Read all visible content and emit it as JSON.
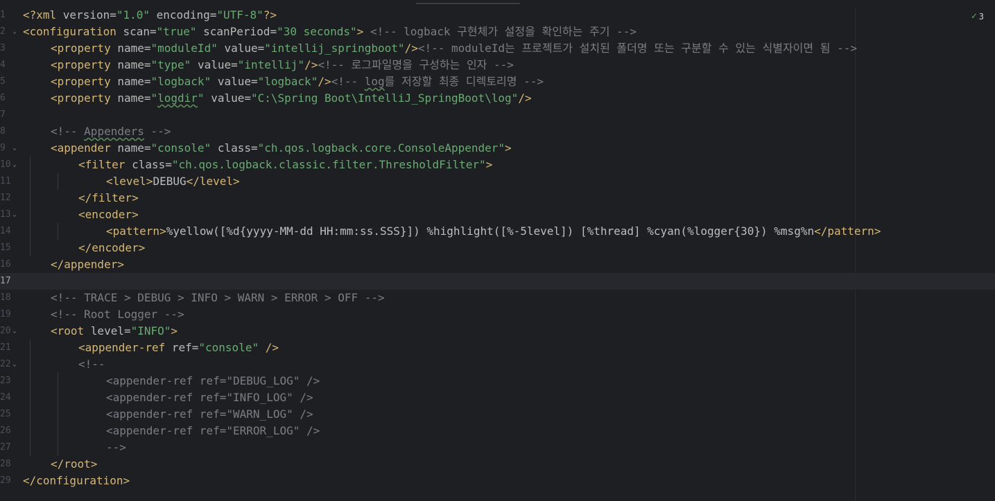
{
  "inspection": {
    "count": "3"
  },
  "current_line": 17,
  "lines": [
    {
      "n": "1",
      "fold": "",
      "indent": 0,
      "tokens": [
        {
          "c": "t",
          "s": "<?xml "
        },
        {
          "c": "a",
          "s": "version="
        },
        {
          "c": "v",
          "s": "\"1.0\" "
        },
        {
          "c": "a",
          "s": "encoding="
        },
        {
          "c": "v",
          "s": "\"UTF-8\""
        },
        {
          "c": "t",
          "s": "?>"
        }
      ]
    },
    {
      "n": "2",
      "fold": "v",
      "indent": 0,
      "tokens": [
        {
          "c": "t",
          "s": "<configuration "
        },
        {
          "c": "a",
          "s": "scan="
        },
        {
          "c": "v",
          "s": "\"true\" "
        },
        {
          "c": "a",
          "s": "scanPeriod="
        },
        {
          "c": "v",
          "s": "\"30 seconds\""
        },
        {
          "c": "t",
          "s": "> "
        },
        {
          "c": "c",
          "s": "<!-- logback 구현체가 설정을 확인하는 주기 -->"
        }
      ]
    },
    {
      "n": "3",
      "fold": "",
      "indent": 1,
      "tokens": [
        {
          "c": "t",
          "s": "<property "
        },
        {
          "c": "a",
          "s": "name="
        },
        {
          "c": "v",
          "s": "\"moduleId\" "
        },
        {
          "c": "a",
          "s": "value="
        },
        {
          "c": "v",
          "s": "\"intellij_springboot\""
        },
        {
          "c": "t",
          "s": "/>"
        },
        {
          "c": "c",
          "s": "<!-- moduleId는 프로젝트가 설치된 폴더명 또는 구분할 수 있는 식별자이면 됨 -->"
        }
      ]
    },
    {
      "n": "4",
      "fold": "",
      "indent": 1,
      "tokens": [
        {
          "c": "t",
          "s": "<property "
        },
        {
          "c": "a",
          "s": "name="
        },
        {
          "c": "v",
          "s": "\"type\" "
        },
        {
          "c": "a",
          "s": "value="
        },
        {
          "c": "v",
          "s": "\"intellij\""
        },
        {
          "c": "t",
          "s": "/>"
        },
        {
          "c": "c",
          "s": "<!-- 로그파일명을 구성하는 인자 -->"
        }
      ]
    },
    {
      "n": "5",
      "fold": "",
      "indent": 1,
      "tokens": [
        {
          "c": "t",
          "s": "<property "
        },
        {
          "c": "a",
          "s": "name="
        },
        {
          "c": "v",
          "s": "\"logback\" "
        },
        {
          "c": "a",
          "s": "value="
        },
        {
          "c": "v",
          "s": "\"logback\""
        },
        {
          "c": "t",
          "s": "/>"
        },
        {
          "c": "c",
          "s": "<!-- "
        },
        {
          "c": "c typo",
          "s": "log"
        },
        {
          "c": "c",
          "s": "를 저장할 최종 디렉토리명 -->"
        }
      ]
    },
    {
      "n": "6",
      "fold": "",
      "indent": 1,
      "tokens": [
        {
          "c": "t",
          "s": "<property "
        },
        {
          "c": "a",
          "s": "name="
        },
        {
          "c": "v",
          "s": "\""
        },
        {
          "c": "v typo",
          "s": "logdir"
        },
        {
          "c": "v",
          "s": "\" "
        },
        {
          "c": "a",
          "s": "value="
        },
        {
          "c": "v",
          "s": "\"C:\\Spring Boot\\IntelliJ_SpringBoot\\log\""
        },
        {
          "c": "t",
          "s": "/>"
        }
      ]
    },
    {
      "n": "7",
      "fold": "",
      "indent": 0,
      "tokens": []
    },
    {
      "n": "8",
      "fold": "",
      "indent": 1,
      "tokens": [
        {
          "c": "c",
          "s": "<!-- "
        },
        {
          "c": "c typo",
          "s": "Appenders"
        },
        {
          "c": "c",
          "s": " -->"
        }
      ]
    },
    {
      "n": "9",
      "fold": "v",
      "indent": 1,
      "tokens": [
        {
          "c": "t",
          "s": "<appender "
        },
        {
          "c": "a",
          "s": "name="
        },
        {
          "c": "v",
          "s": "\"console\" "
        },
        {
          "c": "a",
          "s": "class="
        },
        {
          "c": "v",
          "s": "\"ch.qos.logback.core.ConsoleAppender\""
        },
        {
          "c": "t",
          "s": ">"
        }
      ]
    },
    {
      "n": "10",
      "fold": "v",
      "indent": 2,
      "tokens": [
        {
          "c": "t",
          "s": "<filter "
        },
        {
          "c": "a",
          "s": "class="
        },
        {
          "c": "v",
          "s": "\"ch.qos.logback.classic.filter.ThresholdFilter\""
        },
        {
          "c": "t",
          "s": ">"
        }
      ]
    },
    {
      "n": "11",
      "fold": "",
      "indent": 3,
      "tokens": [
        {
          "c": "t",
          "s": "<level>"
        },
        {
          "c": "x",
          "s": "DEBUG"
        },
        {
          "c": "t",
          "s": "</level>"
        }
      ]
    },
    {
      "n": "12",
      "fold": "",
      "indent": 2,
      "tokens": [
        {
          "c": "t",
          "s": "</filter>"
        }
      ]
    },
    {
      "n": "13",
      "fold": "v",
      "indent": 2,
      "tokens": [
        {
          "c": "t",
          "s": "<encoder>"
        }
      ]
    },
    {
      "n": "14",
      "fold": "",
      "indent": 3,
      "tokens": [
        {
          "c": "t",
          "s": "<pattern>"
        },
        {
          "c": "x",
          "s": "%yellow([%d{yyyy-MM-dd HH:mm:ss.SSS}]) %highlight([%-5level]) [%thread] %cyan(%logger{30}) %msg%n"
        },
        {
          "c": "t",
          "s": "</pattern>"
        }
      ]
    },
    {
      "n": "15",
      "fold": "",
      "indent": 2,
      "tokens": [
        {
          "c": "t",
          "s": "</encoder>"
        }
      ]
    },
    {
      "n": "16",
      "fold": "",
      "indent": 1,
      "tokens": [
        {
          "c": "t",
          "s": "</appender>"
        }
      ]
    },
    {
      "n": "17",
      "fold": "",
      "indent": 0,
      "tokens": []
    },
    {
      "n": "18",
      "fold": "",
      "indent": 1,
      "tokens": [
        {
          "c": "c",
          "s": "<!-- TRACE > DEBUG > INFO > WARN > ERROR > OFF -->"
        }
      ]
    },
    {
      "n": "19",
      "fold": "",
      "indent": 1,
      "tokens": [
        {
          "c": "c",
          "s": "<!-- Root Logger -->"
        }
      ]
    },
    {
      "n": "20",
      "fold": "v",
      "indent": 1,
      "tokens": [
        {
          "c": "t",
          "s": "<root "
        },
        {
          "c": "a",
          "s": "level="
        },
        {
          "c": "v",
          "s": "\"INFO\""
        },
        {
          "c": "t",
          "s": ">"
        }
      ]
    },
    {
      "n": "21",
      "fold": "",
      "indent": 2,
      "tokens": [
        {
          "c": "t",
          "s": "<appender-ref "
        },
        {
          "c": "a",
          "s": "ref="
        },
        {
          "c": "v",
          "s": "\"console\" "
        },
        {
          "c": "t",
          "s": "/>"
        }
      ]
    },
    {
      "n": "22",
      "fold": "v",
      "indent": 2,
      "tokens": [
        {
          "c": "c",
          "s": "<!--"
        }
      ]
    },
    {
      "n": "23",
      "fold": "",
      "indent": 3,
      "tokens": [
        {
          "c": "c",
          "s": "<appender-ref ref=\"DEBUG_LOG\" />"
        }
      ]
    },
    {
      "n": "24",
      "fold": "",
      "indent": 3,
      "tokens": [
        {
          "c": "c",
          "s": "<appender-ref ref=\"INFO_LOG\" />"
        }
      ]
    },
    {
      "n": "25",
      "fold": "",
      "indent": 3,
      "tokens": [
        {
          "c": "c",
          "s": "<appender-ref ref=\"WARN_LOG\" />"
        }
      ]
    },
    {
      "n": "26",
      "fold": "",
      "indent": 3,
      "tokens": [
        {
          "c": "c",
          "s": "<appender-ref ref=\"ERROR_LOG\" />"
        }
      ]
    },
    {
      "n": "27",
      "fold": "",
      "indent": 3,
      "tokens": [
        {
          "c": "c",
          "s": "-->"
        }
      ]
    },
    {
      "n": "28",
      "fold": "",
      "indent": 1,
      "tokens": [
        {
          "c": "t",
          "s": "</root>"
        }
      ]
    },
    {
      "n": "29",
      "fold": "",
      "indent": 0,
      "tokens": [
        {
          "c": "t",
          "s": "</configuration>"
        }
      ]
    }
  ]
}
